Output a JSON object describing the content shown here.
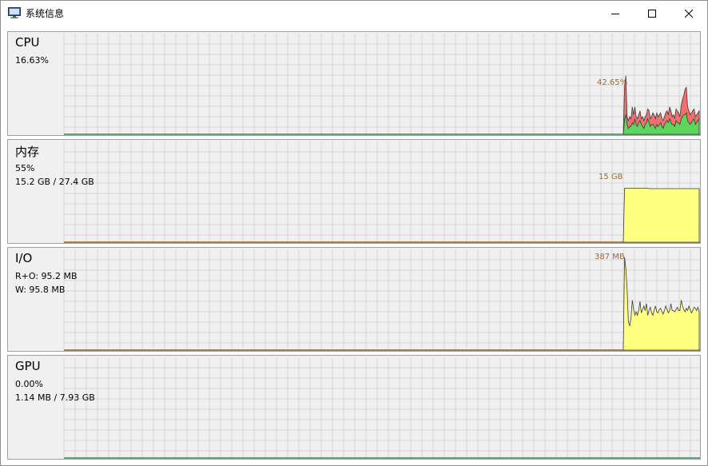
{
  "window": {
    "title": "系统信息",
    "controls": {
      "minimize": "minimize",
      "maximize": "maximize",
      "close": "close"
    }
  },
  "panels": [
    {
      "name": "CPU",
      "lines": [
        "16.63%"
      ],
      "peak_label": "42.65%",
      "series": [
        {
          "role": "upper",
          "color": "#f07070",
          "values": [
            0,
            25,
            30,
            9,
            7,
            9,
            8,
            14,
            10,
            14,
            9,
            8,
            10,
            12,
            8,
            9,
            7,
            9,
            10,
            13,
            12,
            8,
            9,
            11,
            10,
            8,
            11,
            9,
            10,
            11,
            8,
            7,
            9,
            11,
            12,
            10,
            14,
            12,
            9,
            10,
            8,
            13,
            12,
            11,
            9,
            15,
            18,
            20,
            23,
            24,
            14,
            12,
            10,
            11,
            12,
            13,
            9,
            10,
            11,
            12
          ]
        },
        {
          "role": "lower",
          "color": "#5cd65c",
          "values": [
            0,
            8,
            10,
            5,
            3,
            4,
            4,
            6,
            5,
            8,
            5,
            4,
            6,
            7,
            5,
            4,
            3,
            5,
            6,
            8,
            6,
            4,
            5,
            5,
            4,
            3,
            5,
            4,
            5,
            6,
            4,
            3,
            5,
            6,
            7,
            6,
            8,
            6,
            5,
            5,
            4,
            7,
            6,
            6,
            5,
            8,
            9,
            10,
            10,
            11,
            7,
            6,
            5,
            6,
            7,
            8,
            5,
            6,
            7,
            8
          ]
        }
      ]
    },
    {
      "name": "内存",
      "lines": [
        "55%",
        "15.2 GB / 27.4 GB"
      ],
      "peak_label": "15 GB",
      "series": [
        {
          "role": "used",
          "color": "#ffff80",
          "values": [
            0,
            15.15,
            15.15,
            15.15,
            15.15,
            15.15,
            15.15,
            15.15,
            15.15,
            15.15,
            15.15,
            15.15,
            15.15,
            15.15,
            15.15,
            15.15,
            15.15,
            15.15,
            15.15,
            15.15,
            15.05,
            15.05,
            15.05,
            15.05,
            15.05,
            15.05,
            15.05,
            15.05,
            15.05,
            15.05,
            15.05,
            15.05,
            15.05,
            15.05,
            15.05,
            15.05,
            15.05,
            15.05,
            15.05,
            15.05,
            15.05,
            15.05,
            15.05,
            15.05,
            15.05,
            15.05,
            15.05,
            15.05,
            15.05,
            15.05,
            15.05,
            15.05,
            15.05,
            15.05,
            15.05,
            15.05,
            15.05,
            15.05,
            15.05,
            15.05
          ]
        }
      ]
    },
    {
      "name": "I/O",
      "lines": [
        "R+O: 95.2 MB",
        "W: 95.8 MB"
      ],
      "peak_label": "387 MB",
      "series": [
        {
          "role": "io",
          "color": "#ffff80",
          "values": [
            0,
            400,
            350,
            260,
            120,
            105,
            140,
            215,
            175,
            150,
            165,
            150,
            170,
            210,
            160,
            175,
            190,
            170,
            200,
            150,
            170,
            185,
            160,
            150,
            170,
            190,
            165,
            160,
            175,
            180,
            165,
            155,
            170,
            190,
            175,
            160,
            170,
            200,
            170,
            170,
            165,
            175,
            185,
            170,
            170,
            215,
            190,
            175,
            165,
            180,
            170,
            190,
            175,
            160,
            170,
            185,
            180,
            170,
            185,
            165
          ]
        }
      ]
    },
    {
      "name": "GPU",
      "lines": [
        "0.00%",
        "1.14 MB / 7.93 GB"
      ],
      "peak_label": "",
      "series": []
    }
  ]
}
